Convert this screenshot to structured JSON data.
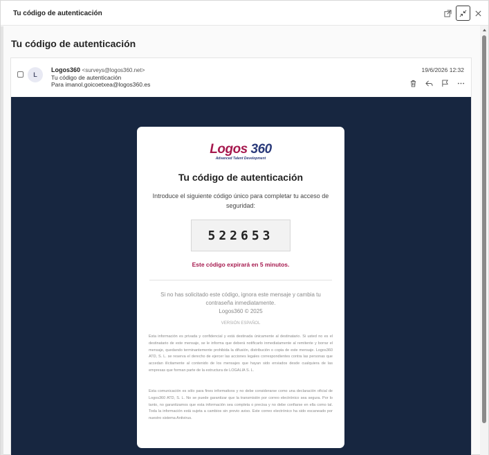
{
  "window": {
    "title": "Tu código de autenticación"
  },
  "subject": "Tu código de autenticación",
  "message": {
    "avatar_initial": "L",
    "sender_name": "Logos360",
    "sender_email": "<surveys@logos360.net>",
    "subject_line": "Tu código de autenticación",
    "to_label": "Para",
    "to_address": "imanol.goicoetxea@logos360.es",
    "date": "19/6/2026 12:32"
  },
  "email": {
    "logo_word": "Logos",
    "logo_num": "360",
    "logo_tagline": "Advanced Talent Development",
    "title": "Tu código de autenticación",
    "intro": "Introduce el siguiente código único para completar tu acceso de seguridad:",
    "code": "522653",
    "expire": "Este código expirará en 5 minutos.",
    "notice": "Si no has solicitado este código, ignora este mensaje y cambia tu contraseña inmediatamente.",
    "copyright": "Logos360 © 2025",
    "version": "VERSIÓN ESPAÑOL",
    "legal1": "Esta información es privada y confidencial y está destinada únicamente al destinatario. Si usted no es el destinatario de este mensaje, se le informa que deberá notificarlo inmediatamente al remitente y borrar el mensaje, quedando terminantemente prohibida la difusión, distribución o copia de este mensaje. Logos360 ATD, S. L. se reserva el derecho de ejercer las acciones legales correspondientes contra las personas que accedan ilícitamente al contenido de los mensajes que hayan sido enviados desde cualquiera de las empresas que forman parte de la estructura de LOGALIA S. L.",
    "legal2": "Esta comunicación es sólo para fines informativos y no debe considerarse como una declaración oficial de Logos360 ATD, S. L. No se puede garantizar que la transmisión por correo electrónico sea segura. Por lo tanto, no garantizamos que esta información sea completa o precisa y no debe confiarse en ella como tal. Toda la información está sujeta a cambios sin previo aviso. Este correo electrónico ha sido escaneado por nuestro sistema Antivirus."
  },
  "icons": {
    "popout": "popout-icon",
    "restore": "restore-icon",
    "close": "close-icon",
    "delete": "trash-icon",
    "reply": "reply-icon",
    "flag": "flag-icon",
    "more": "more-icon"
  },
  "colors": {
    "brand": "#a6194e",
    "brand_secondary": "#2a3a7a",
    "email_background": "#172640"
  }
}
